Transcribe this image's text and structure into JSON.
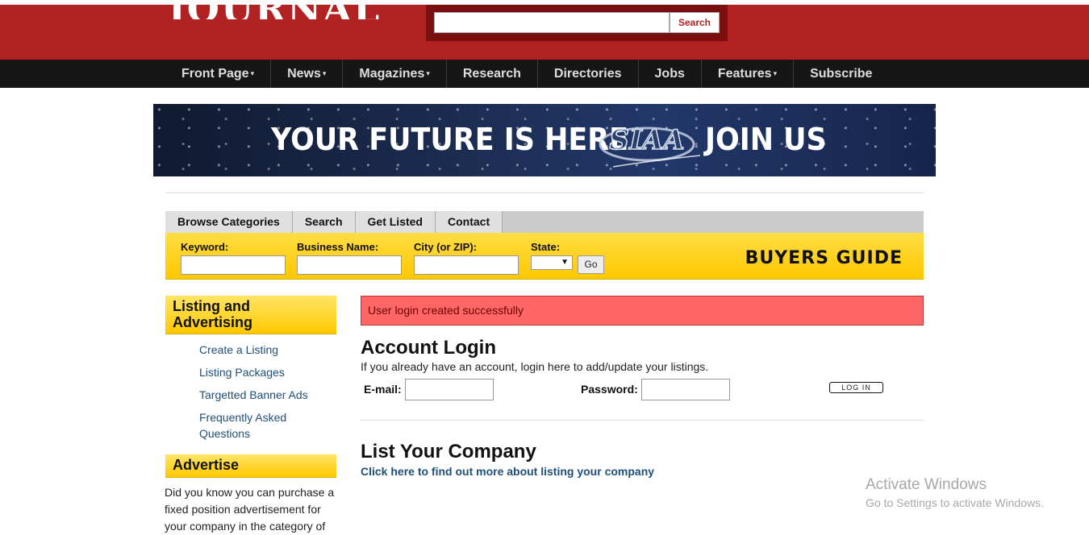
{
  "header": {
    "logo_fragment": "JOURNAL",
    "search_placeholder": "",
    "search_label": "Search"
  },
  "nav": {
    "items": [
      {
        "label": "Front Page",
        "caret": "▾"
      },
      {
        "label": "News",
        "caret": "▾"
      },
      {
        "label": "Magazines",
        "caret": "▾"
      },
      {
        "label": "Research",
        "caret": ""
      },
      {
        "label": "Directories",
        "caret": ""
      },
      {
        "label": "Jobs",
        "caret": ""
      },
      {
        "label": "Features",
        "caret": "▾"
      },
      {
        "label": "Subscribe",
        "caret": ""
      }
    ]
  },
  "banner": {
    "text_left": "YOUR FUTURE IS HERE",
    "logo": "SIAA",
    "text_right": "JOIN US"
  },
  "buyers_guide": {
    "tabs": [
      "Browse Categories",
      "Search",
      "Get Listed",
      "Contact"
    ],
    "keyword_label": "Keyword:",
    "business_label": "Business Name:",
    "city_label": "City (or ZIP):",
    "state_label": "State:",
    "state_value": "",
    "go_label": "Go",
    "title": "BUYERS GUIDE"
  },
  "sidebar": {
    "listing_heading": "Listing and Advertising",
    "links": [
      "Create a Listing",
      "Listing Packages",
      "Targetted Banner Ads",
      "Frequently Asked Questions"
    ],
    "advertise_heading": "Advertise",
    "advertise_text": "Did you know you can purchase a fixed position advertisement for your company in the category of"
  },
  "main": {
    "alert": "User login created successfully",
    "login_title": "Account Login",
    "login_sub": "If you already have an account, login here to add/update your listings.",
    "email_label": "E-mail:",
    "password_label": "Password:",
    "login_button": "LOG IN",
    "list_title": "List Your Company",
    "list_link": "Click here to find out more about listing your company"
  },
  "watermark": {
    "line1": "Activate Windows",
    "line2": "Go to Settings to activate Windows."
  },
  "colors": {
    "header_red": "#b22222",
    "nav_black": "#161616",
    "guide_yellow": "#ffc800",
    "alert_red": "#ff6666",
    "link_blue": "#1f4e79"
  }
}
